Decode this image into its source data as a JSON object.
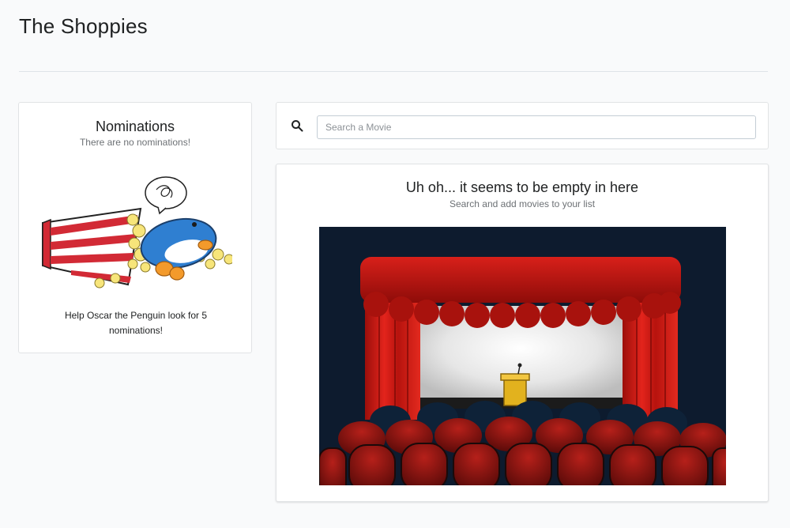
{
  "app": {
    "title": "The Shoppies"
  },
  "nominations": {
    "title": "Nominations",
    "subtitle": "There are no nominations!",
    "help_text": "Help Oscar the Penguin look for 5 nominations!",
    "illustration_icon": "penguin-popcorn-illustration"
  },
  "search": {
    "icon": "search-icon",
    "placeholder": "Search a Movie",
    "value": ""
  },
  "empty_state": {
    "title": "Uh oh... it seems to be empty in here",
    "subtitle": "Search and add movies to your list",
    "illustration_icon": "movie-theater-illustration"
  },
  "colors": {
    "background": "#f9fafb",
    "card": "#ffffff",
    "text": "#202223",
    "subdued_text": "#6d7175",
    "curtain_red": "#c8150e",
    "theater_navy": "#0d1b2e"
  }
}
